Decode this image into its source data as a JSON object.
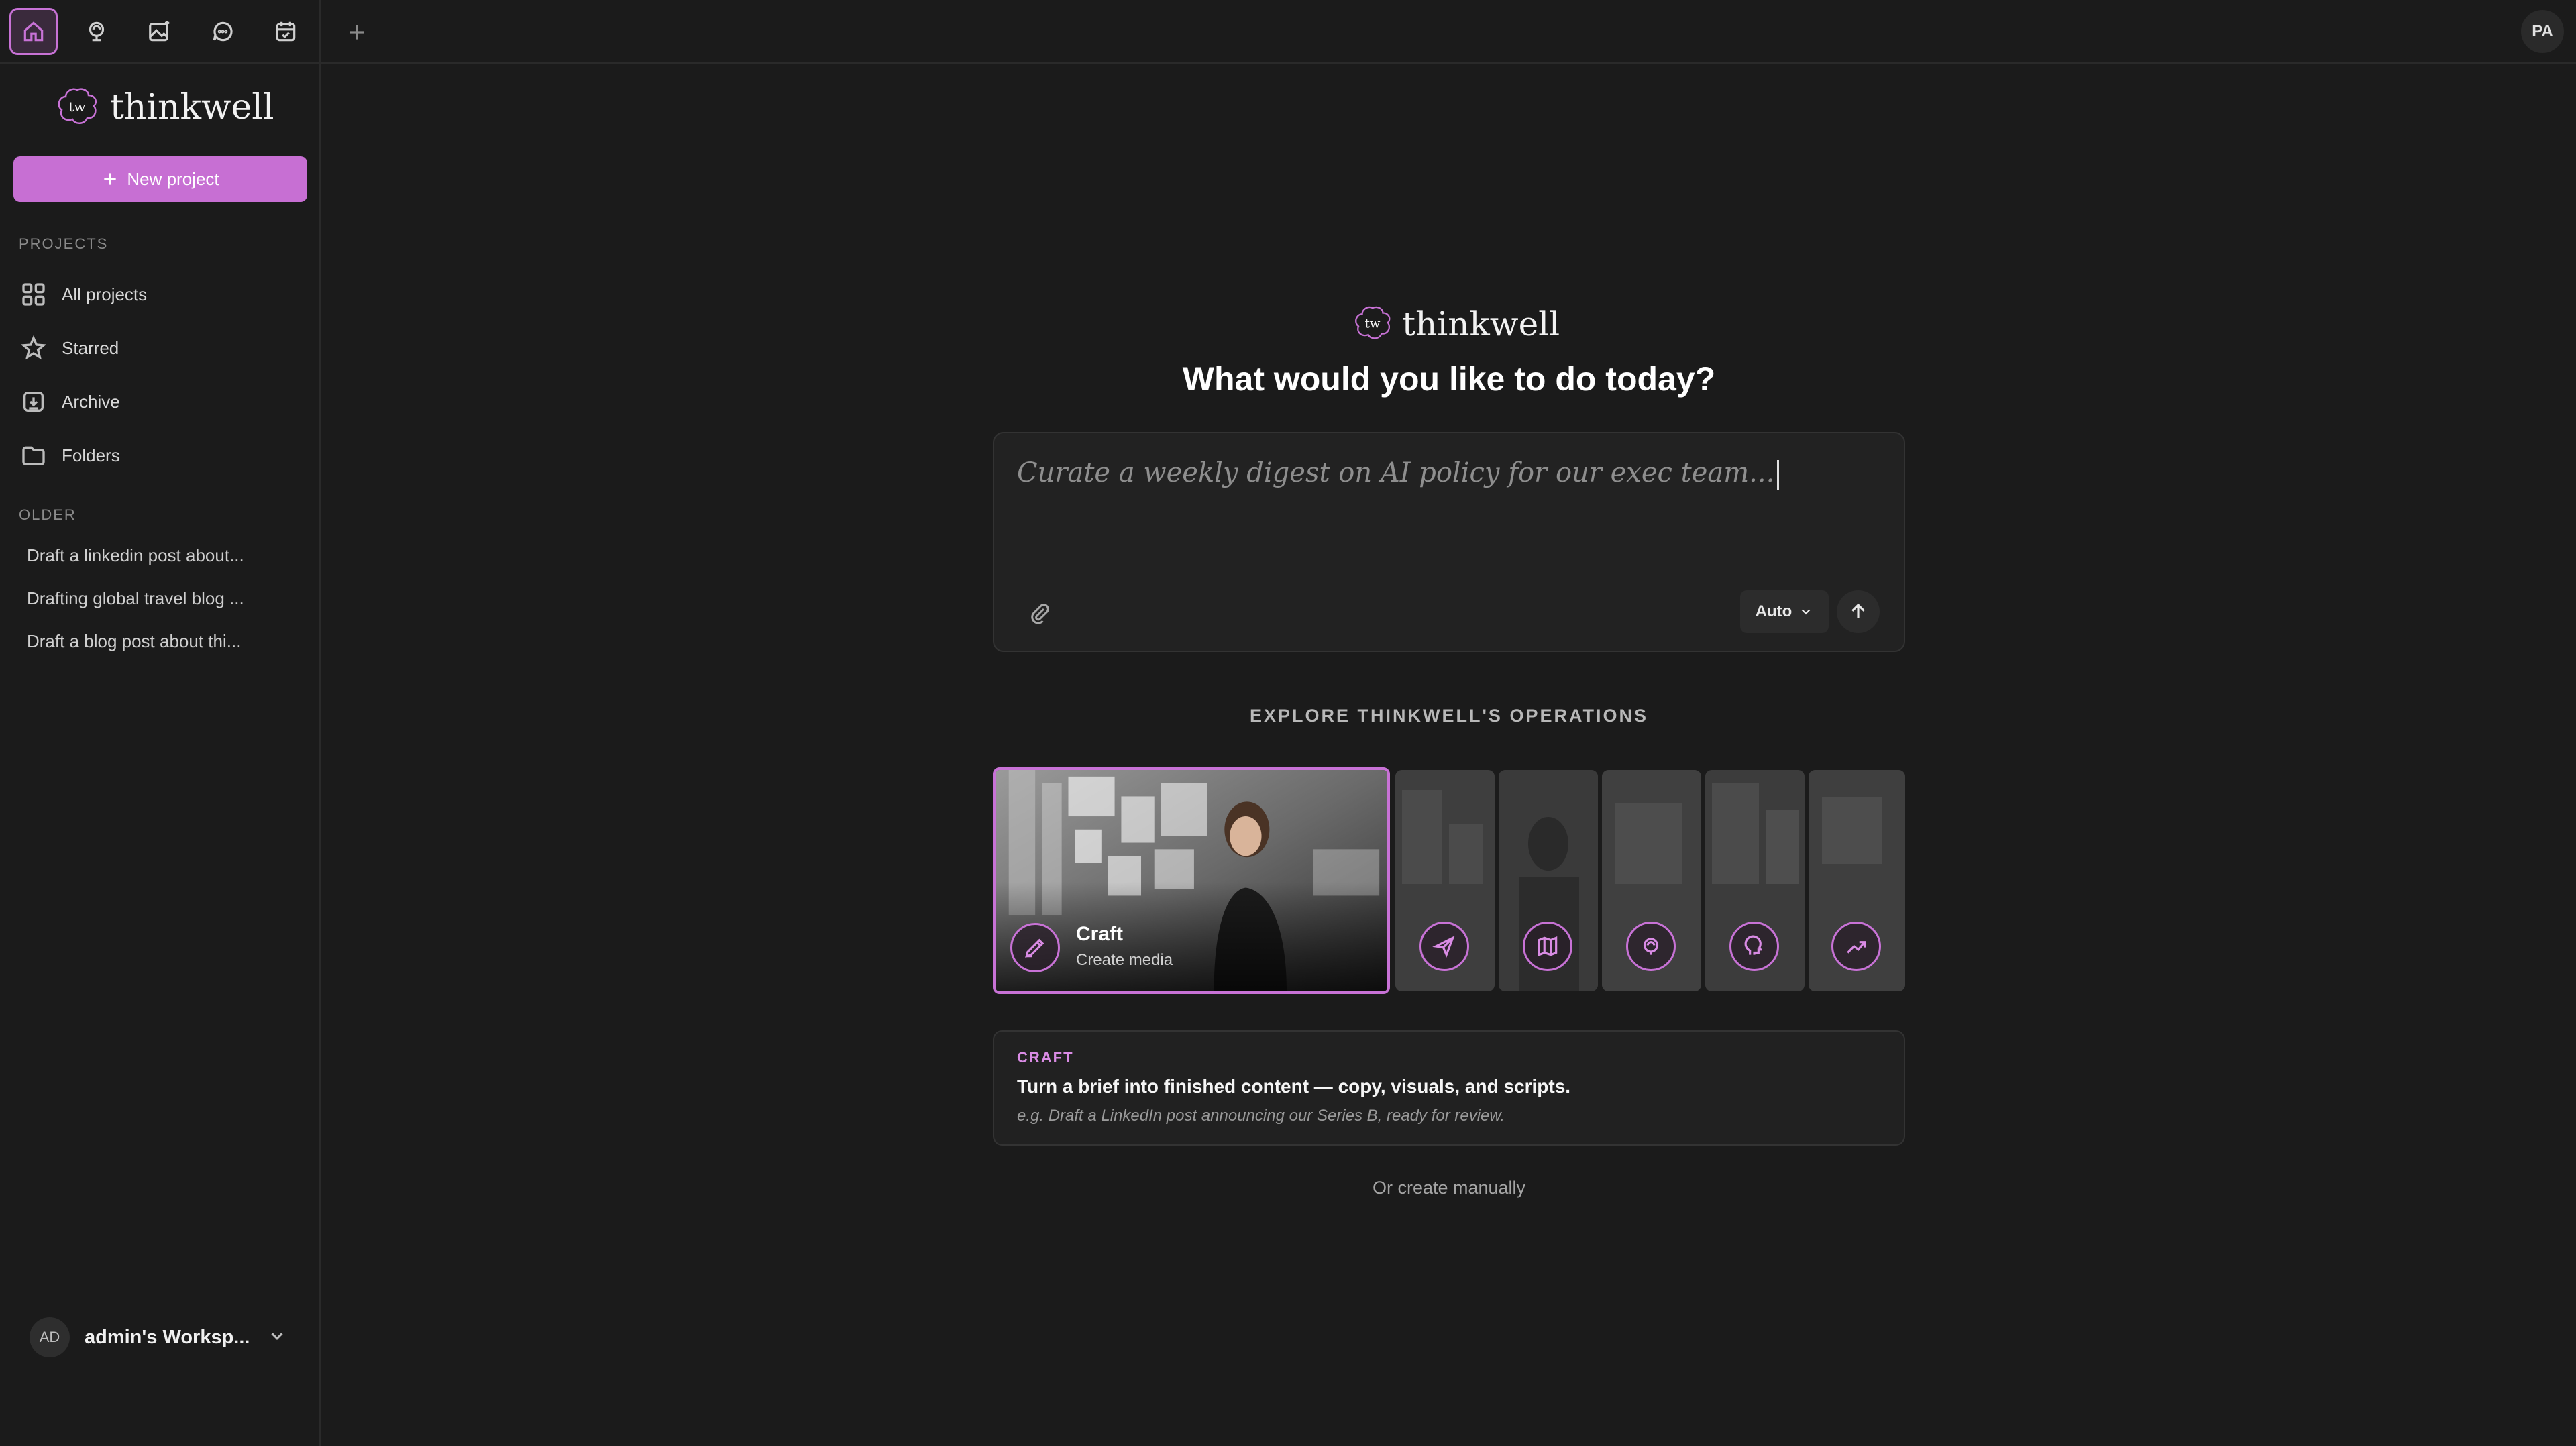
{
  "topbar": {
    "tabs": [
      {
        "icon": "home-icon",
        "active": true
      },
      {
        "icon": "brain-icon",
        "active": false
      },
      {
        "icon": "image-sparkle-icon",
        "active": false
      },
      {
        "icon": "chat-icon",
        "active": false
      },
      {
        "icon": "calendar-icon",
        "active": false
      }
    ],
    "user_initials": "PA"
  },
  "brand": {
    "name": "thinkwell",
    "mark": "tw"
  },
  "sidebar": {
    "new_project_label": "New project",
    "projects_label": "PROJECTS",
    "nav": [
      {
        "label": "All projects",
        "icon": "grid-icon"
      },
      {
        "label": "Starred",
        "icon": "star-icon"
      },
      {
        "label": "Archive",
        "icon": "archive-icon"
      },
      {
        "label": "Folders",
        "icon": "folder-icon"
      }
    ],
    "older_label": "OLDER",
    "older": [
      "Draft a linkedin post about...",
      "Drafting global travel blog ...",
      "Draft a blog post about thi..."
    ],
    "workspace": {
      "initials": "AD",
      "name": "admin's Worksp..."
    }
  },
  "main": {
    "headline": "What would you like to do today?",
    "prompt_placeholder": "Curate a weekly digest on AI policy for our exec team...",
    "model_select": "Auto",
    "explore_label": "EXPLORE THINKWELL'S OPERATIONS",
    "operations": [
      {
        "title": "Craft",
        "subtitle": "Create media",
        "icon": "pen-icon",
        "active": true
      },
      {
        "icon": "send-icon"
      },
      {
        "icon": "map-icon"
      },
      {
        "icon": "brain-icon"
      },
      {
        "icon": "head-icon"
      },
      {
        "icon": "trend-icon"
      }
    ],
    "detail": {
      "tag": "CRAFT",
      "title": "Turn a brief into finished content — copy, visuals, and scripts.",
      "example": "e.g. Draft a LinkedIn post announcing our Series B, ready for review."
    },
    "manual_label": "Or create manually"
  },
  "colors": {
    "accent": "#c872d6",
    "background": "#1b1b1b",
    "panel": "#222222"
  }
}
